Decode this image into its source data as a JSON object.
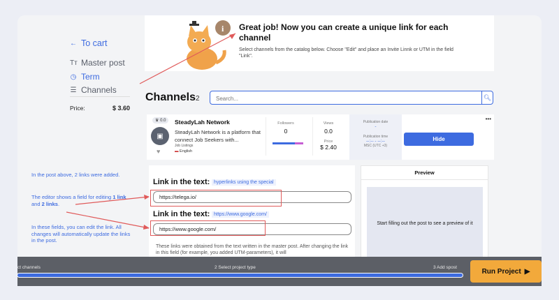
{
  "nav": {
    "to_cart": "To cart",
    "master_post": "Master post",
    "term": "Term",
    "channels": "Channels",
    "price_label": "Price:",
    "price_value": "$ 3.60"
  },
  "banner": {
    "title": "Great job! Now you can create a unique link for each channel",
    "subtitle": "Select channels from the catalog below. Choose \"Edit\" and place an Invite Linnk or UTM in the field \"Link\"."
  },
  "channels": {
    "title": "Channels",
    "count": "2",
    "search_placeholder": "Search..."
  },
  "channel_row": {
    "badge": "0.0",
    "name": "SteadyLah Network",
    "description": "SteadyLah Network is a platform that connect Job Seekers with...",
    "category": "Job Listings",
    "language": "English",
    "followers_label": "Followers",
    "followers_value": "0",
    "views_label": "Views",
    "views_value": "0.0",
    "price_label": "Price",
    "price_value": "$ 2.40",
    "pub_date_label": "Publication date",
    "pub_date_value": "-",
    "pub_time_label": "Publication time",
    "pub_time_value": "--:-- - --:--",
    "tz": "MSC (UTC +3)",
    "hide_label": "Hide",
    "more": "•••",
    "followers_fill": 0.7
  },
  "editor": {
    "link1_title": "Link in the text:",
    "link1_hint": "hyperlinks using the special",
    "link1_value": "https://telega.io/",
    "link2_title": "Link in the text:",
    "link2_hint": "https://www.google.com/",
    "link2_value": "https://www.google.com/",
    "note": "These links were obtained from the text written in the master post. After changing the link in this field (for example, you added UTM-parameters), it will"
  },
  "preview": {
    "title": "Preview",
    "placeholder": "Start filling out the post to see a preview of it"
  },
  "annotations": {
    "a1": "In the post above, 2 links were added.",
    "a2_pre": "The editor shows a field for editing ",
    "a2_b1": "1 link",
    "a2_mid": " and ",
    "a2_b2": "2 links",
    "a2_post": ".",
    "a3": "In these fields, you can edit the link. All changes will automatically update the links in the post."
  },
  "footer": {
    "step1": "ct channels",
    "step2": "2 Select project type",
    "step3": "3 Add spost",
    "run_label": "Run Project"
  },
  "colors": {
    "accent": "#3d6be0",
    "run": "#f2a93b",
    "annotation_red": "#e05a5a"
  }
}
